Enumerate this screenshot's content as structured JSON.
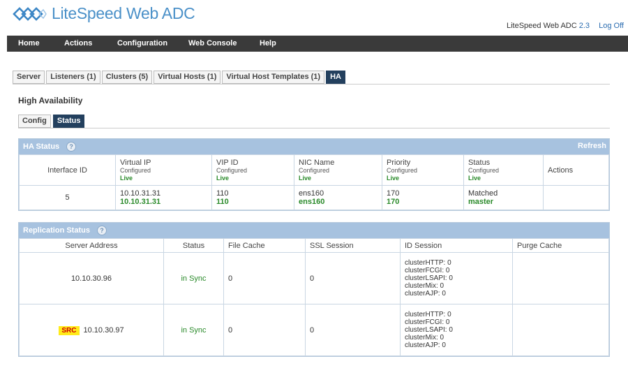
{
  "header": {
    "logo_text": "LiteSpeed Web ADC",
    "product": "LiteSpeed Web ADC",
    "version": "2.3",
    "logoff": "Log Off"
  },
  "nav": {
    "items": [
      "Home",
      "Actions",
      "Configuration",
      "Web Console",
      "Help"
    ]
  },
  "tabs": [
    "Server",
    "Listeners (1)",
    "Clusters (5)",
    "Virtual Hosts (1)",
    "Virtual Host Templates (1)",
    "HA"
  ],
  "section_title": "High Availability",
  "subtabs": [
    "Config",
    "Status"
  ],
  "ha_status": {
    "title": "HA Status",
    "help": "?",
    "refresh": "Refresh",
    "columns": {
      "interface_id": "Interface ID",
      "virtual_ip": "Virtual IP",
      "vip_id": "VIP ID",
      "nic_name": "NIC Name",
      "priority": "Priority",
      "status": "Status",
      "actions": "Actions",
      "configured": "Configured",
      "live": "Live"
    },
    "row": {
      "interface_id": "5",
      "virtual_ip_cfg": "10.10.31.31",
      "virtual_ip_live": "10.10.31.31",
      "vip_id_cfg": "110",
      "vip_id_live": "110",
      "nic_cfg": "ens160",
      "nic_live": "ens160",
      "priority_cfg": "170",
      "priority_live": "170",
      "status_cfg": "Matched",
      "status_live": "master",
      "actions": ""
    }
  },
  "replication": {
    "title": "Replication Status",
    "help": "?",
    "columns": {
      "server_address": "Server Address",
      "status": "Status",
      "file_cache": "File Cache",
      "ssl_session": "SSL Session",
      "id_session": "ID Session",
      "purge_cache": "Purge Cache"
    },
    "rows": [
      {
        "src": "",
        "address": "10.10.30.96",
        "status": "in Sync",
        "file_cache": "0",
        "ssl_session": "0",
        "id_session": [
          "clusterHTTP: 0",
          "clusterFCGI: 0",
          "clusterLSAPI: 0",
          "clusterMix: 0",
          "clusterAJP: 0"
        ],
        "purge_cache": ""
      },
      {
        "src": "SRC",
        "address": "10.10.30.97",
        "status": "in Sync",
        "file_cache": "0",
        "ssl_session": "0",
        "id_session": [
          "clusterHTTP: 0",
          "clusterFCGI: 0",
          "clusterLSAPI: 0",
          "clusterMix: 0",
          "clusterAJP: 0"
        ],
        "purge_cache": ""
      }
    ]
  },
  "colors": {
    "brand": "#4a90c8",
    "navbar": "#3a3a3a",
    "active_tab": "#23405e",
    "panel_head": "#a7c2df",
    "live": "#2a8a2a",
    "src_badge": "#ffeb1a"
  }
}
